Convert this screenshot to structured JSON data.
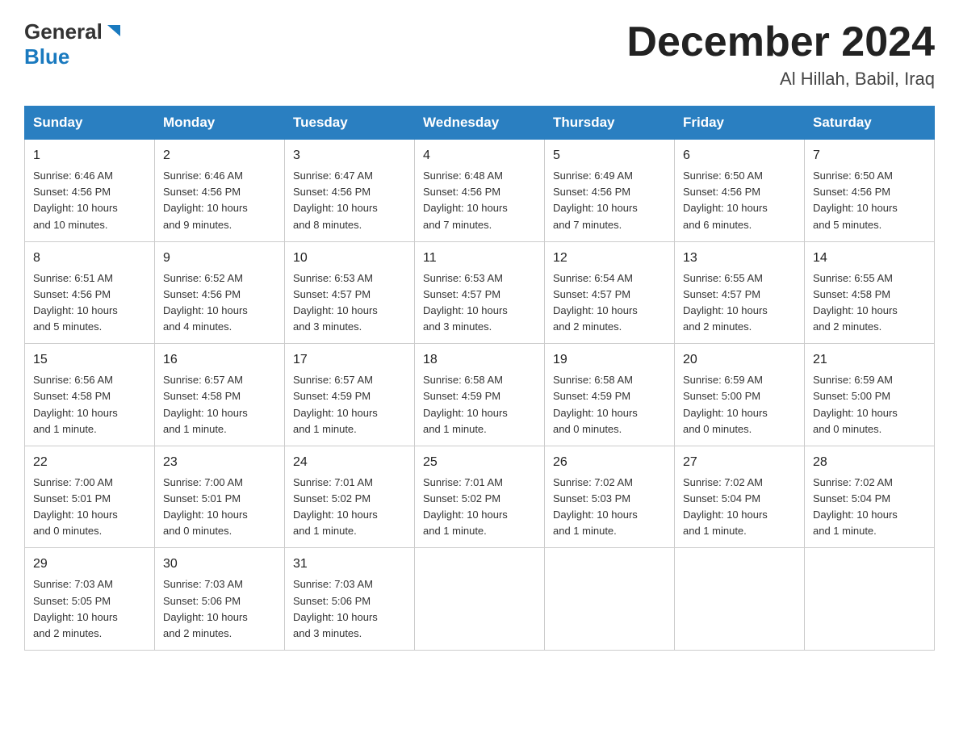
{
  "header": {
    "logo_general": "General",
    "logo_blue": "Blue",
    "month_title": "December 2024",
    "location": "Al Hillah, Babil, Iraq"
  },
  "weekdays": [
    "Sunday",
    "Monday",
    "Tuesday",
    "Wednesday",
    "Thursday",
    "Friday",
    "Saturday"
  ],
  "weeks": [
    [
      {
        "day": "1",
        "sunrise": "6:46 AM",
        "sunset": "4:56 PM",
        "daylight": "10 hours and 10 minutes."
      },
      {
        "day": "2",
        "sunrise": "6:46 AM",
        "sunset": "4:56 PM",
        "daylight": "10 hours and 9 minutes."
      },
      {
        "day": "3",
        "sunrise": "6:47 AM",
        "sunset": "4:56 PM",
        "daylight": "10 hours and 8 minutes."
      },
      {
        "day": "4",
        "sunrise": "6:48 AM",
        "sunset": "4:56 PM",
        "daylight": "10 hours and 7 minutes."
      },
      {
        "day": "5",
        "sunrise": "6:49 AM",
        "sunset": "4:56 PM",
        "daylight": "10 hours and 7 minutes."
      },
      {
        "day": "6",
        "sunrise": "6:50 AM",
        "sunset": "4:56 PM",
        "daylight": "10 hours and 6 minutes."
      },
      {
        "day": "7",
        "sunrise": "6:50 AM",
        "sunset": "4:56 PM",
        "daylight": "10 hours and 5 minutes."
      }
    ],
    [
      {
        "day": "8",
        "sunrise": "6:51 AM",
        "sunset": "4:56 PM",
        "daylight": "10 hours and 5 minutes."
      },
      {
        "day": "9",
        "sunrise": "6:52 AM",
        "sunset": "4:56 PM",
        "daylight": "10 hours and 4 minutes."
      },
      {
        "day": "10",
        "sunrise": "6:53 AM",
        "sunset": "4:57 PM",
        "daylight": "10 hours and 3 minutes."
      },
      {
        "day": "11",
        "sunrise": "6:53 AM",
        "sunset": "4:57 PM",
        "daylight": "10 hours and 3 minutes."
      },
      {
        "day": "12",
        "sunrise": "6:54 AM",
        "sunset": "4:57 PM",
        "daylight": "10 hours and 2 minutes."
      },
      {
        "day": "13",
        "sunrise": "6:55 AM",
        "sunset": "4:57 PM",
        "daylight": "10 hours and 2 minutes."
      },
      {
        "day": "14",
        "sunrise": "6:55 AM",
        "sunset": "4:58 PM",
        "daylight": "10 hours and 2 minutes."
      }
    ],
    [
      {
        "day": "15",
        "sunrise": "6:56 AM",
        "sunset": "4:58 PM",
        "daylight": "10 hours and 1 minute."
      },
      {
        "day": "16",
        "sunrise": "6:57 AM",
        "sunset": "4:58 PM",
        "daylight": "10 hours and 1 minute."
      },
      {
        "day": "17",
        "sunrise": "6:57 AM",
        "sunset": "4:59 PM",
        "daylight": "10 hours and 1 minute."
      },
      {
        "day": "18",
        "sunrise": "6:58 AM",
        "sunset": "4:59 PM",
        "daylight": "10 hours and 1 minute."
      },
      {
        "day": "19",
        "sunrise": "6:58 AM",
        "sunset": "4:59 PM",
        "daylight": "10 hours and 0 minutes."
      },
      {
        "day": "20",
        "sunrise": "6:59 AM",
        "sunset": "5:00 PM",
        "daylight": "10 hours and 0 minutes."
      },
      {
        "day": "21",
        "sunrise": "6:59 AM",
        "sunset": "5:00 PM",
        "daylight": "10 hours and 0 minutes."
      }
    ],
    [
      {
        "day": "22",
        "sunrise": "7:00 AM",
        "sunset": "5:01 PM",
        "daylight": "10 hours and 0 minutes."
      },
      {
        "day": "23",
        "sunrise": "7:00 AM",
        "sunset": "5:01 PM",
        "daylight": "10 hours and 0 minutes."
      },
      {
        "day": "24",
        "sunrise": "7:01 AM",
        "sunset": "5:02 PM",
        "daylight": "10 hours and 1 minute."
      },
      {
        "day": "25",
        "sunrise": "7:01 AM",
        "sunset": "5:02 PM",
        "daylight": "10 hours and 1 minute."
      },
      {
        "day": "26",
        "sunrise": "7:02 AM",
        "sunset": "5:03 PM",
        "daylight": "10 hours and 1 minute."
      },
      {
        "day": "27",
        "sunrise": "7:02 AM",
        "sunset": "5:04 PM",
        "daylight": "10 hours and 1 minute."
      },
      {
        "day": "28",
        "sunrise": "7:02 AM",
        "sunset": "5:04 PM",
        "daylight": "10 hours and 1 minute."
      }
    ],
    [
      {
        "day": "29",
        "sunrise": "7:03 AM",
        "sunset": "5:05 PM",
        "daylight": "10 hours and 2 minutes."
      },
      {
        "day": "30",
        "sunrise": "7:03 AM",
        "sunset": "5:06 PM",
        "daylight": "10 hours and 2 minutes."
      },
      {
        "day": "31",
        "sunrise": "7:03 AM",
        "sunset": "5:06 PM",
        "daylight": "10 hours and 3 minutes."
      },
      null,
      null,
      null,
      null
    ]
  ],
  "labels": {
    "sunrise": "Sunrise:",
    "sunset": "Sunset:",
    "daylight": "Daylight:"
  }
}
